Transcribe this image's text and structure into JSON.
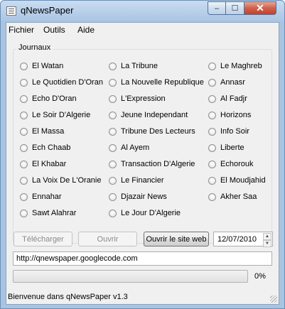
{
  "window": {
    "title": "qNewsPaper",
    "close_glyph": "✕",
    "max_glyph": "☐",
    "min_glyph": "–"
  },
  "menu": [
    "Fichier",
    "Outils",
    "Aide"
  ],
  "group": {
    "title": "Journaux",
    "columns": [
      [
        "El Watan",
        "Le Quotidien D'Oran",
        "Echo D'Oran",
        "Le Soir D'Algerie",
        "El Massa",
        "Ech Chaab",
        "El Khabar",
        "La Voix De L'Oranie",
        "Ennahar",
        "Sawt Alahrar"
      ],
      [
        "La Tribune",
        "La Nouvelle Republique",
        "L'Expression",
        "Jeune Independant",
        "Tribune Des Lecteurs",
        "Al Ayem",
        "Transaction D'Algerie",
        "Le Financier",
        "Djazair News",
        "Le Jour D'Algerie"
      ],
      [
        "Le Maghreb",
        "Annasr",
        "Al Fadjr",
        "Horizons",
        "Info Soir",
        "Liberte",
        "Echorouk",
        "El Moudjahid",
        "Akher Saa"
      ]
    ]
  },
  "buttons": {
    "download": "Télécharger",
    "open": "Ouvrir",
    "open_site": "Ouvrir le site web"
  },
  "date": "12/07/2010",
  "url": "http://qnewspaper.googlecode.com",
  "progress": {
    "value": 0,
    "label": "0%"
  },
  "status": "Bienvenue dans qNewsPaper v1.3"
}
